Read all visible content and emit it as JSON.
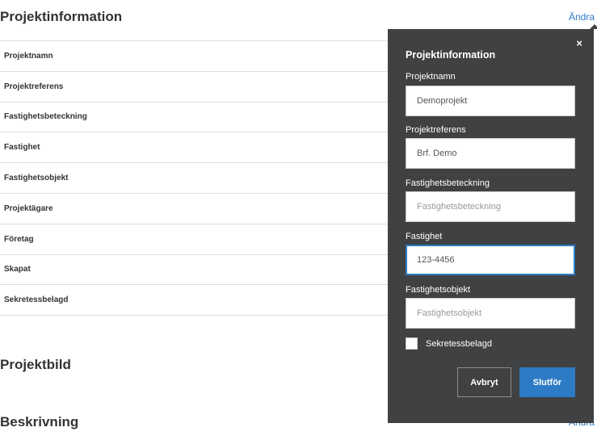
{
  "page": {
    "sections": {
      "info_title": "Projektinformation",
      "bild_title": "Projektbild",
      "beskrivning_title": "Beskrivning"
    },
    "edit_label": "Ändra",
    "info_rows": [
      "Projektnamn",
      "Projektreferens",
      "Fastighetsbeteckning",
      "Fastighet",
      "Fastighetsobjekt",
      "Projektägare",
      "Företag",
      "Skapat",
      "Sekretessbelagd"
    ]
  },
  "popover": {
    "title": "Projektinformation",
    "close_glyph": "×",
    "fields": {
      "projektnamn": {
        "label": "Projektnamn",
        "value": "Demoprojekt",
        "placeholder": ""
      },
      "projektreferens": {
        "label": "Projektreferens",
        "value": "Brf. Demo",
        "placeholder": ""
      },
      "fastighetsbeteckning": {
        "label": "Fastighetsbeteckning",
        "value": "",
        "placeholder": "Fastighetsbeteckning"
      },
      "fastighet": {
        "label": "Fastighet",
        "value": "123-4456",
        "placeholder": ""
      },
      "fastighetsobjekt": {
        "label": "Fastighetsobjekt",
        "value": "",
        "placeholder": "Fastighetsobjekt"
      }
    },
    "checkbox_label": "Sekretessbelagd",
    "checkbox_checked": false,
    "cancel_label": "Avbryt",
    "submit_label": "Slutför"
  },
  "colors": {
    "accent": "#2d7bc4",
    "popover_bg": "#3f4143",
    "divider": "#dcdcdc"
  }
}
